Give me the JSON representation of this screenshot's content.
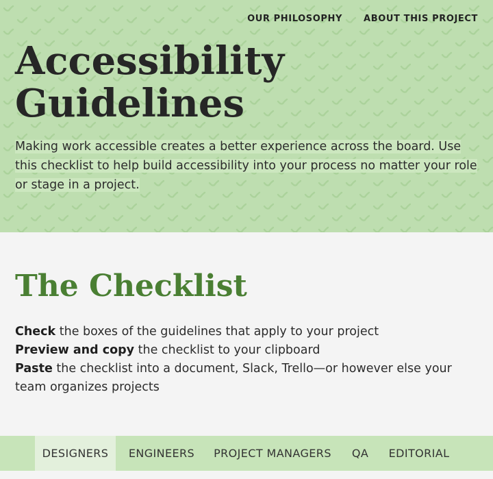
{
  "nav": {
    "philosophy": "OUR PHILOSOPHY",
    "about": "ABOUT THIS PROJECT"
  },
  "hero": {
    "title_line1": "Accessibility",
    "title_line2": "Guidelines",
    "description": "Making work accessible creates a better experience across the board. Use this checklist to help build accessibility into your process no matter your role or stage in a project."
  },
  "checklist": {
    "title": "The Checklist",
    "steps": [
      {
        "bold": "Check",
        "text": " the boxes of the guidelines that apply to your project"
      },
      {
        "bold": "Preview and copy",
        "text": " the checklist to your clipboard"
      },
      {
        "bold": "Paste",
        "text": " the checklist into a document, Slack, Trello—or however else your team organizes projects"
      }
    ]
  },
  "tabs": [
    {
      "label": "DESIGNERS",
      "active": true
    },
    {
      "label": "ENGINEERS",
      "active": false
    },
    {
      "label": "PROJECT MANAGERS",
      "active": false
    },
    {
      "label": "QA",
      "active": false
    },
    {
      "label": "EDITORIAL",
      "active": false
    }
  ],
  "colors": {
    "hero_bg": "#bedeb0",
    "accent_green": "#4a7f33",
    "tab_bar_bg": "#c7e4b9",
    "active_tab_bg": "#e3f0dc",
    "page_bg": "#f4f4f4"
  }
}
